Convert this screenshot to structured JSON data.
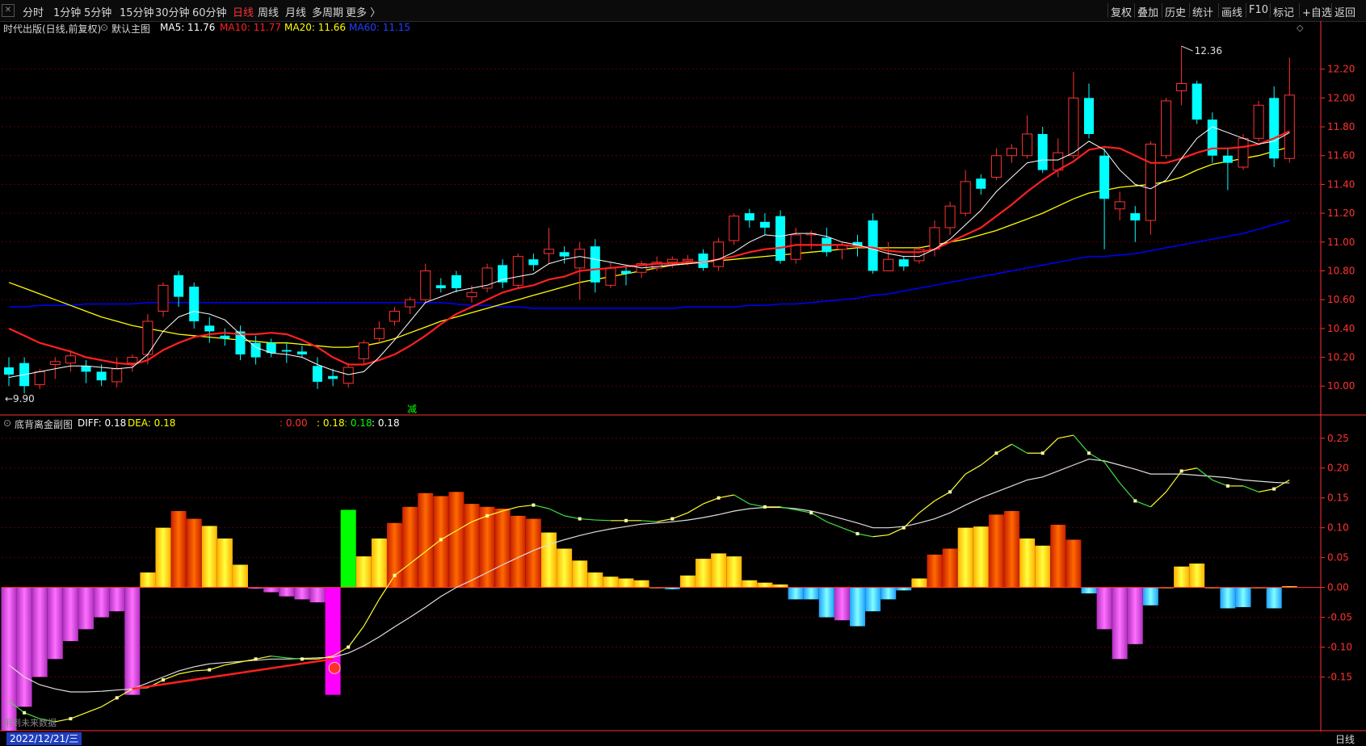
{
  "toolbar": {
    "periods": [
      "分时",
      "1分钟",
      "5分钟",
      "15分钟",
      "30分钟",
      "60分钟",
      "日线",
      "周线",
      "月线",
      "多周期",
      "更多 〉"
    ],
    "active_period": "日线",
    "right_buttons": [
      "复权",
      "叠加",
      "历史",
      "统计",
      "画线",
      "F10",
      "标记",
      "+自选",
      "返回"
    ]
  },
  "main_info": {
    "title": "时代出版(日线,前复权)",
    "indicator_name": "默认主图",
    "ma5": "MA5: 11.76",
    "ma10": "MA10: 11.77",
    "ma20": "MA20: 11.66",
    "ma60": "MA60: 11.15"
  },
  "sub_info": {
    "indicator_name": "底背离金副图",
    "diff": "DIFF: 0.18",
    "dea": "DEA: 0.18",
    "v1": ": 0.00",
    "v2": ": 0.18",
    "v3": ": 0.18",
    "v4": ": 0.18"
  },
  "colors": {
    "up": "#ff3232",
    "down": "#00ffff",
    "ma5": "#ffffff",
    "ma10": "#ff2020",
    "ma20": "#ffff00",
    "ma60": "#0000ff",
    "axis": "#ff3232",
    "grid": "#5a0000"
  },
  "chart_data": [
    {
      "type": "candlestick",
      "name": "main",
      "ylim": [
        9.85,
        12.4
      ],
      "yticks": [
        10.0,
        10.2,
        10.4,
        10.6,
        10.8,
        11.0,
        11.2,
        11.4,
        11.6,
        11.8,
        12.0,
        12.2
      ],
      "ytick_labels": [
        "10.00",
        "10.20",
        "10.40",
        "10.60",
        "10.80",
        "11.00",
        "11.20",
        "11.40",
        "11.60",
        "11.80",
        "12.00",
        "12.20"
      ],
      "annotations": {
        "high_label": "12.36",
        "low_label": "9.90",
        "marker_label": "减"
      },
      "month_markers": [
        "1",
        "2",
        "3",
        "4"
      ],
      "candles": [
        [
          10.13,
          10.08,
          10.2,
          10.0
        ],
        [
          10.16,
          10.0,
          10.2,
          9.95
        ],
        [
          10.01,
          10.1,
          10.12,
          9.98
        ],
        [
          10.15,
          10.17,
          10.2,
          10.05
        ],
        [
          10.16,
          10.21,
          10.25,
          10.1
        ],
        [
          10.14,
          10.1,
          10.18,
          10.02
        ],
        [
          10.1,
          10.04,
          10.15,
          10.0
        ],
        [
          10.03,
          10.12,
          10.2,
          9.99
        ],
        [
          10.16,
          10.2,
          10.22,
          10.1
        ],
        [
          10.22,
          10.45,
          10.5,
          10.15
        ],
        [
          10.52,
          10.7,
          10.72,
          10.48
        ],
        [
          10.77,
          10.62,
          10.8,
          10.55
        ],
        [
          10.69,
          10.45,
          10.72,
          10.4
        ],
        [
          10.42,
          10.38,
          10.48,
          10.3
        ],
        [
          10.35,
          10.33,
          10.4,
          10.28
        ],
        [
          10.38,
          10.22,
          10.42,
          10.18
        ],
        [
          10.3,
          10.2,
          10.35,
          10.15
        ],
        [
          10.3,
          10.23,
          10.33,
          10.2
        ],
        [
          10.25,
          10.24,
          10.3,
          10.16
        ],
        [
          10.24,
          10.22,
          10.28,
          10.2
        ],
        [
          10.14,
          10.03,
          10.2,
          9.98
        ],
        [
          10.07,
          10.05,
          10.12,
          10.0
        ],
        [
          10.02,
          10.13,
          10.16,
          9.99
        ],
        [
          10.19,
          10.3,
          10.32,
          10.15
        ],
        [
          10.33,
          10.4,
          10.45,
          10.3
        ],
        [
          10.45,
          10.52,
          10.55,
          10.42
        ],
        [
          10.55,
          10.6,
          10.62,
          10.5
        ],
        [
          10.6,
          10.8,
          10.85,
          10.58
        ],
        [
          10.7,
          10.68,
          10.75,
          10.65
        ],
        [
          10.77,
          10.68,
          10.8,
          10.65
        ],
        [
          10.62,
          10.65,
          10.7,
          10.58
        ],
        [
          10.68,
          10.82,
          10.85,
          10.65
        ],
        [
          10.84,
          10.72,
          10.88,
          10.68
        ],
        [
          10.7,
          10.9,
          10.92,
          10.68
        ],
        [
          10.88,
          10.84,
          10.92,
          10.8
        ],
        [
          10.92,
          10.95,
          11.1,
          10.85
        ],
        [
          10.93,
          10.9,
          10.97,
          10.85
        ],
        [
          10.82,
          10.95,
          11.0,
          10.6
        ],
        [
          10.97,
          10.72,
          11.02,
          10.65
        ],
        [
          10.7,
          10.82,
          10.86,
          10.68
        ],
        [
          10.8,
          10.78,
          10.83,
          10.7
        ],
        [
          10.79,
          10.85,
          10.87,
          10.75
        ],
        [
          10.82,
          10.86,
          10.9,
          10.8
        ],
        [
          10.86,
          10.88,
          10.9,
          10.82
        ],
        [
          10.87,
          10.88,
          10.91,
          10.84
        ],
        [
          10.92,
          10.82,
          10.95,
          10.8
        ],
        [
          10.83,
          11.0,
          11.03,
          10.8
        ],
        [
          11.01,
          11.18,
          11.2,
          10.98
        ],
        [
          11.2,
          11.15,
          11.23,
          11.1
        ],
        [
          11.14,
          11.1,
          11.2,
          11.05
        ],
        [
          11.18,
          10.87,
          11.22,
          10.85
        ],
        [
          10.88,
          11.05,
          11.1,
          10.85
        ],
        [
          11.05,
          11.06,
          11.08,
          10.95
        ],
        [
          11.03,
          10.93,
          11.1,
          10.9
        ],
        [
          10.95,
          10.98,
          11.0,
          10.88
        ],
        [
          11.0,
          10.97,
          11.05,
          10.9
        ],
        [
          11.15,
          10.8,
          11.2,
          10.78
        ],
        [
          10.8,
          10.88,
          11.0,
          10.8
        ],
        [
          10.88,
          10.83,
          10.9,
          10.8
        ],
        [
          10.87,
          10.95,
          10.97,
          10.85
        ],
        [
          10.95,
          11.1,
          11.15,
          10.9
        ],
        [
          11.1,
          11.25,
          11.28,
          11.05
        ],
        [
          11.2,
          11.42,
          11.5,
          11.18
        ],
        [
          11.44,
          11.37,
          11.47,
          11.33
        ],
        [
          11.45,
          11.6,
          11.65,
          11.43
        ],
        [
          11.6,
          11.65,
          11.68,
          11.55
        ],
        [
          11.6,
          11.75,
          11.88,
          11.58
        ],
        [
          11.75,
          11.5,
          11.8,
          11.48
        ],
        [
          11.5,
          11.62,
          11.72,
          11.45
        ],
        [
          11.6,
          12.0,
          12.18,
          11.58
        ],
        [
          12.0,
          11.75,
          12.1,
          11.72
        ],
        [
          11.6,
          11.3,
          11.65,
          10.95
        ],
        [
          11.23,
          11.28,
          11.35,
          11.15
        ],
        [
          11.2,
          11.15,
          11.25,
          11.0
        ],
        [
          11.15,
          11.68,
          11.7,
          11.05
        ],
        [
          11.6,
          11.98,
          12.0,
          11.58
        ],
        [
          12.05,
          12.1,
          12.36,
          11.95
        ],
        [
          12.1,
          11.85,
          12.12,
          11.82
        ],
        [
          11.85,
          11.6,
          11.9,
          11.55
        ],
        [
          11.6,
          11.55,
          11.65,
          11.36
        ],
        [
          11.52,
          11.72,
          11.75,
          11.5
        ],
        [
          11.72,
          11.95,
          11.98,
          11.7
        ],
        [
          12.0,
          11.58,
          12.08,
          11.52
        ],
        [
          11.58,
          12.02,
          12.28,
          11.55
        ]
      ],
      "ma5": [
        10.06,
        10.08,
        10.1,
        10.12,
        10.14,
        10.14,
        10.13,
        10.12,
        10.13,
        10.22,
        10.38,
        10.48,
        10.52,
        10.5,
        10.46,
        10.36,
        10.27,
        10.23,
        10.22,
        10.2,
        10.15,
        10.11,
        10.08,
        10.1,
        10.2,
        10.32,
        10.45,
        10.58,
        10.62,
        10.66,
        10.68,
        10.7,
        10.74,
        10.76,
        10.78,
        10.85,
        10.88,
        10.9,
        10.88,
        10.86,
        10.84,
        10.82,
        10.83,
        10.84,
        10.85,
        10.86,
        10.88,
        10.93,
        11.0,
        11.05,
        11.04,
        11.06,
        11.06,
        11.04,
        11.0,
        10.98,
        10.95,
        10.92,
        10.9,
        10.9,
        10.95,
        11.02,
        11.12,
        11.22,
        11.35,
        11.45,
        11.55,
        11.57,
        11.57,
        11.62,
        11.7,
        11.64,
        11.5,
        11.4,
        11.37,
        11.43,
        11.58,
        11.72,
        11.8,
        11.76,
        11.72,
        11.68,
        11.7,
        11.76
      ],
      "ma10": [
        10.4,
        10.35,
        10.3,
        10.27,
        10.24,
        10.2,
        10.18,
        10.16,
        10.15,
        10.18,
        10.25,
        10.3,
        10.34,
        10.36,
        10.37,
        10.36,
        10.36,
        10.37,
        10.36,
        10.32,
        10.27,
        10.2,
        10.15,
        10.15,
        10.18,
        10.22,
        10.28,
        10.35,
        10.43,
        10.5,
        10.55,
        10.6,
        10.65,
        10.68,
        10.7,
        10.74,
        10.76,
        10.8,
        10.81,
        10.82,
        10.83,
        10.84,
        10.85,
        10.85,
        10.86,
        10.86,
        10.88,
        10.9,
        10.93,
        10.95,
        10.96,
        10.98,
        10.98,
        10.98,
        10.98,
        10.97,
        10.96,
        10.94,
        10.93,
        10.93,
        10.95,
        11.0,
        11.05,
        11.1,
        11.18,
        11.26,
        11.35,
        11.43,
        11.5,
        11.56,
        11.64,
        11.66,
        11.65,
        11.6,
        11.55,
        11.55,
        11.58,
        11.62,
        11.65,
        11.65,
        11.66,
        11.68,
        11.72,
        11.77
      ],
      "ma20": [
        10.72,
        10.68,
        10.64,
        10.6,
        10.56,
        10.52,
        10.48,
        10.45,
        10.42,
        10.4,
        10.38,
        10.36,
        10.35,
        10.34,
        10.33,
        10.32,
        10.31,
        10.3,
        10.3,
        10.29,
        10.28,
        10.27,
        10.27,
        10.28,
        10.3,
        10.33,
        10.37,
        10.41,
        10.45,
        10.48,
        10.51,
        10.54,
        10.57,
        10.6,
        10.63,
        10.66,
        10.69,
        10.72,
        10.74,
        10.76,
        10.78,
        10.8,
        10.82,
        10.84,
        10.85,
        10.86,
        10.87,
        10.88,
        10.89,
        10.9,
        10.91,
        10.92,
        10.93,
        10.94,
        10.95,
        10.96,
        10.96,
        10.96,
        10.96,
        10.96,
        10.98,
        11.0,
        11.02,
        11.05,
        11.08,
        11.12,
        11.16,
        11.2,
        11.25,
        11.3,
        11.34,
        11.36,
        11.38,
        11.39,
        11.4,
        11.42,
        11.45,
        11.5,
        11.54,
        11.56,
        11.58,
        11.6,
        11.63,
        11.66
      ],
      "ma60": [
        10.55,
        10.55,
        10.56,
        10.56,
        10.56,
        10.57,
        10.57,
        10.57,
        10.57,
        10.58,
        10.58,
        10.58,
        10.58,
        10.58,
        10.58,
        10.58,
        10.58,
        10.58,
        10.58,
        10.58,
        10.58,
        10.58,
        10.58,
        10.58,
        10.58,
        10.58,
        10.58,
        10.58,
        10.58,
        10.57,
        10.56,
        10.56,
        10.55,
        10.55,
        10.54,
        10.54,
        10.54,
        10.54,
        10.54,
        10.54,
        10.54,
        10.54,
        10.54,
        10.54,
        10.55,
        10.55,
        10.55,
        10.55,
        10.56,
        10.56,
        10.57,
        10.57,
        10.58,
        10.59,
        10.6,
        10.61,
        10.63,
        10.64,
        10.66,
        10.68,
        10.7,
        10.72,
        10.74,
        10.76,
        10.78,
        10.8,
        10.82,
        10.84,
        10.86,
        10.88,
        10.9,
        10.9,
        10.91,
        10.92,
        10.94,
        10.96,
        10.98,
        11.0,
        11.02,
        11.04,
        11.06,
        11.09,
        11.12,
        11.15
      ]
    },
    {
      "type": "bar",
      "name": "sub-macd",
      "ylim": [
        -0.24,
        0.27
      ],
      "yticks": [
        -0.15,
        -0.1,
        -0.05,
        0.0,
        0.05,
        0.1,
        0.15,
        0.2,
        0.25
      ],
      "ytick_labels": [
        "-0.15",
        "-0.10",
        "-0.05",
        "0.00",
        "0.05",
        "0.10",
        "0.15",
        "0.20",
        "0.25"
      ],
      "annotations": {
        "bottom_note": "用到未来数据"
      },
      "bars": [
        -0.24,
        -0.2,
        -0.15,
        -0.12,
        -0.09,
        -0.07,
        -0.05,
        -0.04,
        -0.18,
        0.025,
        0.1,
        0.128,
        0.115,
        0.103,
        0.082,
        0.038,
        -0.002,
        -0.008,
        -0.015,
        -0.02,
        -0.025,
        -0.18,
        0.13,
        0.052,
        0.082,
        0.108,
        0.135,
        0.158,
        0.153,
        0.16,
        0.14,
        0.135,
        0.132,
        0.12,
        0.115,
        0.092,
        0.065,
        0.045,
        0.025,
        0.018,
        0.015,
        0.012,
        0.0,
        -0.003,
        0.02,
        0.048,
        0.057,
        0.052,
        0.012,
        0.008,
        0.005,
        -0.02,
        -0.02,
        -0.05,
        -0.055,
        -0.065,
        -0.04,
        -0.02,
        -0.005,
        0.015,
        0.055,
        0.065,
        0.1,
        0.102,
        0.122,
        0.128,
        0.082,
        0.07,
        0.105,
        0.08,
        -0.01,
        -0.07,
        -0.12,
        -0.095,
        -0.03,
        0.0,
        0.035,
        0.04,
        0.0,
        -0.035,
        -0.033,
        0.0,
        -0.035,
        0.002
      ],
      "special_bars": {
        "8": "#ffff00",
        "21": "#ff00ff",
        "22": "#00ff00"
      },
      "diff": [
        -0.19,
        -0.21,
        -0.22,
        -0.225,
        -0.22,
        -0.21,
        -0.2,
        -0.185,
        -0.17,
        -0.168,
        -0.155,
        -0.145,
        -0.14,
        -0.138,
        -0.13,
        -0.125,
        -0.12,
        -0.115,
        -0.118,
        -0.12,
        -0.12,
        -0.115,
        -0.1,
        -0.065,
        -0.02,
        0.02,
        0.04,
        0.06,
        0.08,
        0.095,
        0.11,
        0.12,
        0.128,
        0.135,
        0.138,
        0.132,
        0.12,
        0.115,
        0.113,
        0.112,
        0.112,
        0.112,
        0.11,
        0.115,
        0.125,
        0.14,
        0.15,
        0.155,
        0.14,
        0.135,
        0.135,
        0.13,
        0.125,
        0.11,
        0.1,
        0.09,
        0.085,
        0.088,
        0.1,
        0.125,
        0.145,
        0.16,
        0.19,
        0.205,
        0.225,
        0.24,
        0.225,
        0.225,
        0.25,
        0.255,
        0.225,
        0.21,
        0.175,
        0.145,
        0.135,
        0.16,
        0.195,
        0.2,
        0.18,
        0.17,
        0.17,
        0.16,
        0.165,
        0.18
      ],
      "dea": [
        -0.13,
        -0.15,
        -0.163,
        -0.17,
        -0.175,
        -0.175,
        -0.174,
        -0.172,
        -0.17,
        -0.16,
        -0.15,
        -0.14,
        -0.133,
        -0.128,
        -0.126,
        -0.124,
        -0.122,
        -0.12,
        -0.12,
        -0.119,
        -0.118,
        -0.117,
        -0.11,
        -0.098,
        -0.083,
        -0.066,
        -0.05,
        -0.033,
        -0.015,
        0.0,
        0.012,
        0.025,
        0.038,
        0.05,
        0.062,
        0.072,
        0.08,
        0.087,
        0.093,
        0.098,
        0.102,
        0.106,
        0.108,
        0.11,
        0.113,
        0.117,
        0.122,
        0.128,
        0.132,
        0.134,
        0.134,
        0.132,
        0.128,
        0.122,
        0.115,
        0.108,
        0.1,
        0.1,
        0.102,
        0.108,
        0.115,
        0.125,
        0.138,
        0.15,
        0.16,
        0.17,
        0.18,
        0.185,
        0.195,
        0.205,
        0.215,
        0.212,
        0.205,
        0.198,
        0.19,
        0.19,
        0.19,
        0.188,
        0.186,
        0.184,
        0.18,
        0.178,
        0.176,
        0.175
      ]
    }
  ]
}
